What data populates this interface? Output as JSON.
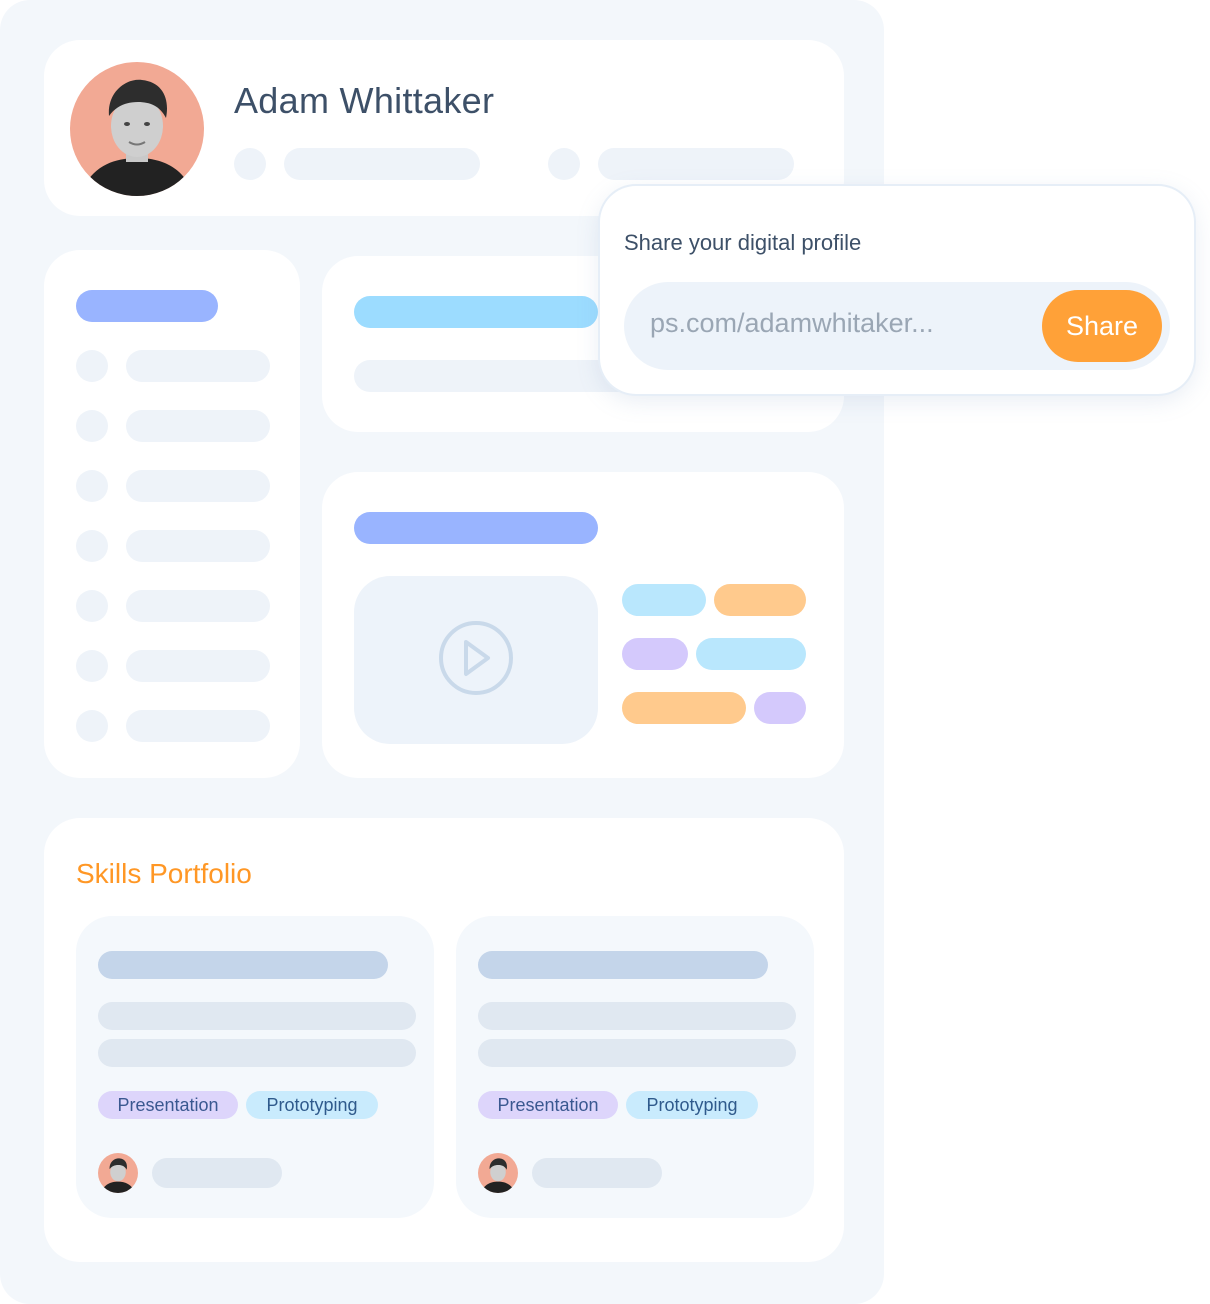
{
  "profile": {
    "name": "Adam Whittaker"
  },
  "share": {
    "title": "Share your digital profile",
    "url": "ps.com/adamwhitaker...",
    "button_label": "Share"
  },
  "skills": {
    "title": "Skills Portfolio",
    "cards": [
      {
        "tags": [
          "Presentation",
          "Prototyping"
        ]
      },
      {
        "tags": [
          "Presentation",
          "Prototyping"
        ]
      }
    ]
  },
  "colors": {
    "accent_orange": "#ffa138",
    "skills_title": "#ff9725",
    "heading_text": "#3d5068",
    "placeholder_blue": "#99b4ff",
    "placeholder_cyan": "#9cdcff",
    "tag_purple": "#ddd5fb",
    "tag_blue": "#c9ebfd"
  },
  "icons": [
    "play-icon",
    "profile-photo"
  ]
}
